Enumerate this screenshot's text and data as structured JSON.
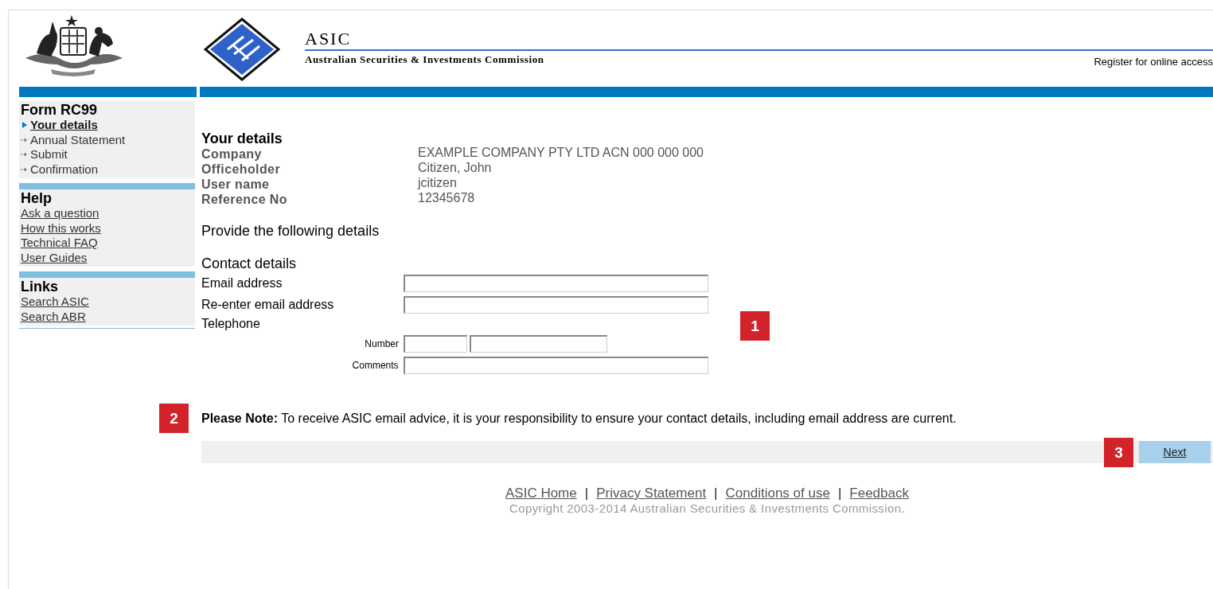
{
  "header": {
    "title": "ASIC",
    "subtitle": "Australian Securities & Investments Commission",
    "register_link": "Register for online access"
  },
  "sidebar": {
    "sections": [
      {
        "title": "Form RC99",
        "kind": "steps",
        "items": [
          {
            "label": "Your details",
            "selected": true
          },
          {
            "label": "Annual Statement",
            "selected": false
          },
          {
            "label": "Submit",
            "selected": false
          },
          {
            "label": "Confirmation",
            "selected": false
          }
        ]
      },
      {
        "title": "Help",
        "kind": "links",
        "items": [
          {
            "label": "Ask a question"
          },
          {
            "label": "How this works"
          },
          {
            "label": "Technical FAQ"
          },
          {
            "label": "User Guides"
          }
        ]
      },
      {
        "title": "Links",
        "kind": "links",
        "items": [
          {
            "label": "Search ASIC"
          },
          {
            "label": "Search ABR"
          }
        ]
      }
    ]
  },
  "main": {
    "heading": "Your details",
    "details": [
      {
        "label": "Company",
        "value": "EXAMPLE COMPANY PTY LTD ACN 000 000 000"
      },
      {
        "label": "Officeholder",
        "value": "Citizen, John"
      },
      {
        "label": "User name",
        "value": "jcitizen"
      },
      {
        "label": "Reference No",
        "value": "12345678"
      }
    ],
    "prompt": "Provide the following details",
    "contact": {
      "heading": "Contact details",
      "callout": "1",
      "fields": [
        {
          "label": "Email address",
          "kind": "text"
        },
        {
          "label": "Re-enter email address",
          "kind": "text"
        },
        {
          "label": "Telephone",
          "kind": "heading"
        },
        {
          "label": "Number",
          "kind": "phone"
        },
        {
          "label": "Comments",
          "kind": "sub"
        }
      ]
    },
    "note": {
      "text": "**Please Note:** To receive ASIC email advice, it is your responsibility to ensure your contact details, including email address are current.",
      "callout": "2"
    },
    "button_bar": {
      "next_button": "Next",
      "callout": "3"
    }
  },
  "footer": {
    "links": [
      "ASIC Home",
      "Privacy Statement",
      "Conditions of use",
      "Feedback"
    ],
    "separator": "|",
    "copyright": "Copyright 2003-2014 Australian Securities & Investments Commission."
  }
}
